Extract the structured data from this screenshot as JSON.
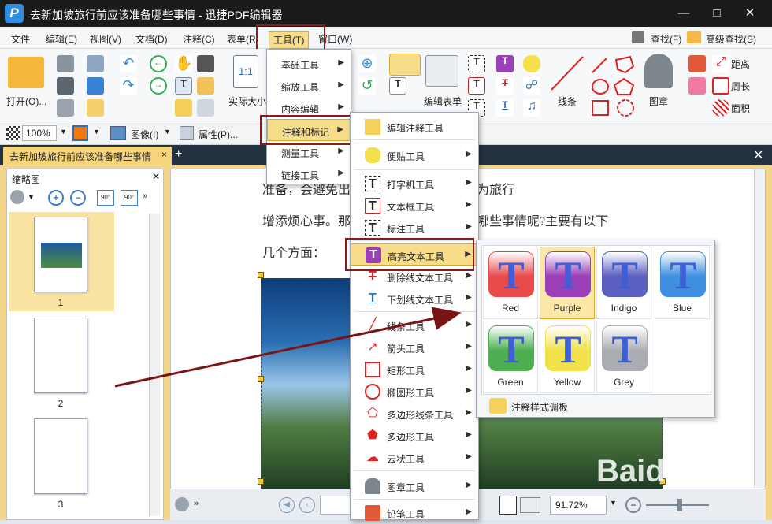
{
  "window": {
    "title": "去新加坡旅行前应该准备哪些事情 - 迅捷PDF编辑器",
    "app_icon": "P"
  },
  "menubar": [
    "文件",
    "编辑(E)",
    "视图(V)",
    "文档(D)",
    "注释(C)",
    "表单(R)",
    "工具(T)",
    "窗口(W)"
  ],
  "menubar_right": {
    "find": "查找(F)",
    "advanced_find": "高级查找(S)"
  },
  "ribbon": {
    "open": "打开(O)...",
    "actual_size": "实际大小",
    "line": "线条",
    "stamp": "图章",
    "edit_form": "编辑表单",
    "distance": "距离",
    "perimeter": "周长",
    "area": "面积"
  },
  "toolbar2": {
    "zoom": "100%",
    "image": "图像(I)",
    "properties": "属性(P)..."
  },
  "tab": {
    "label": "去新加坡旅行前应该准备哪些事情",
    "close": "×",
    "add": "+"
  },
  "thumb_panel": {
    "title": "缩略图",
    "pages": [
      "1",
      "2",
      "3"
    ]
  },
  "doc": {
    "line1": "准备，会避免出现一些不必要的问题，为旅行",
    "line2": "增添烦心事。那么去新加坡前应该了解哪些事情呢?主要有以下",
    "line3": "几个方面："
  },
  "status": {
    "zoom": "91.72%"
  },
  "tools_menu": [
    "基础工具",
    "缩放工具",
    "内容编辑",
    "注释和标记",
    "测量工具",
    "链接工具"
  ],
  "annot_menu": [
    "编辑注释工具",
    "便贴工具",
    "打字机工具",
    "文本框工具",
    "标注工具",
    "高亮文本工具",
    "删除线文本工具",
    "下划线文本工具",
    "线条工具",
    "箭头工具",
    "矩形工具",
    "椭圆形工具",
    "多边形线条工具",
    "多边形工具",
    "云状工具",
    "图章工具",
    "铅笔工具"
  ],
  "highlight_colors": [
    {
      "name": "Red",
      "color": "#e84b4b"
    },
    {
      "name": "Purple",
      "color": "#9a3fb8"
    },
    {
      "name": "Indigo",
      "color": "#5a5fc0"
    },
    {
      "name": "Blue",
      "color": "#3f8fe0"
    },
    {
      "name": "Green",
      "color": "#4fae52"
    },
    {
      "name": "Yellow",
      "color": "#f2e14a"
    },
    {
      "name": "Grey",
      "color": "#a9adb2"
    }
  ],
  "style_palette": "注释样式调板",
  "watermark": "Baidu经验"
}
